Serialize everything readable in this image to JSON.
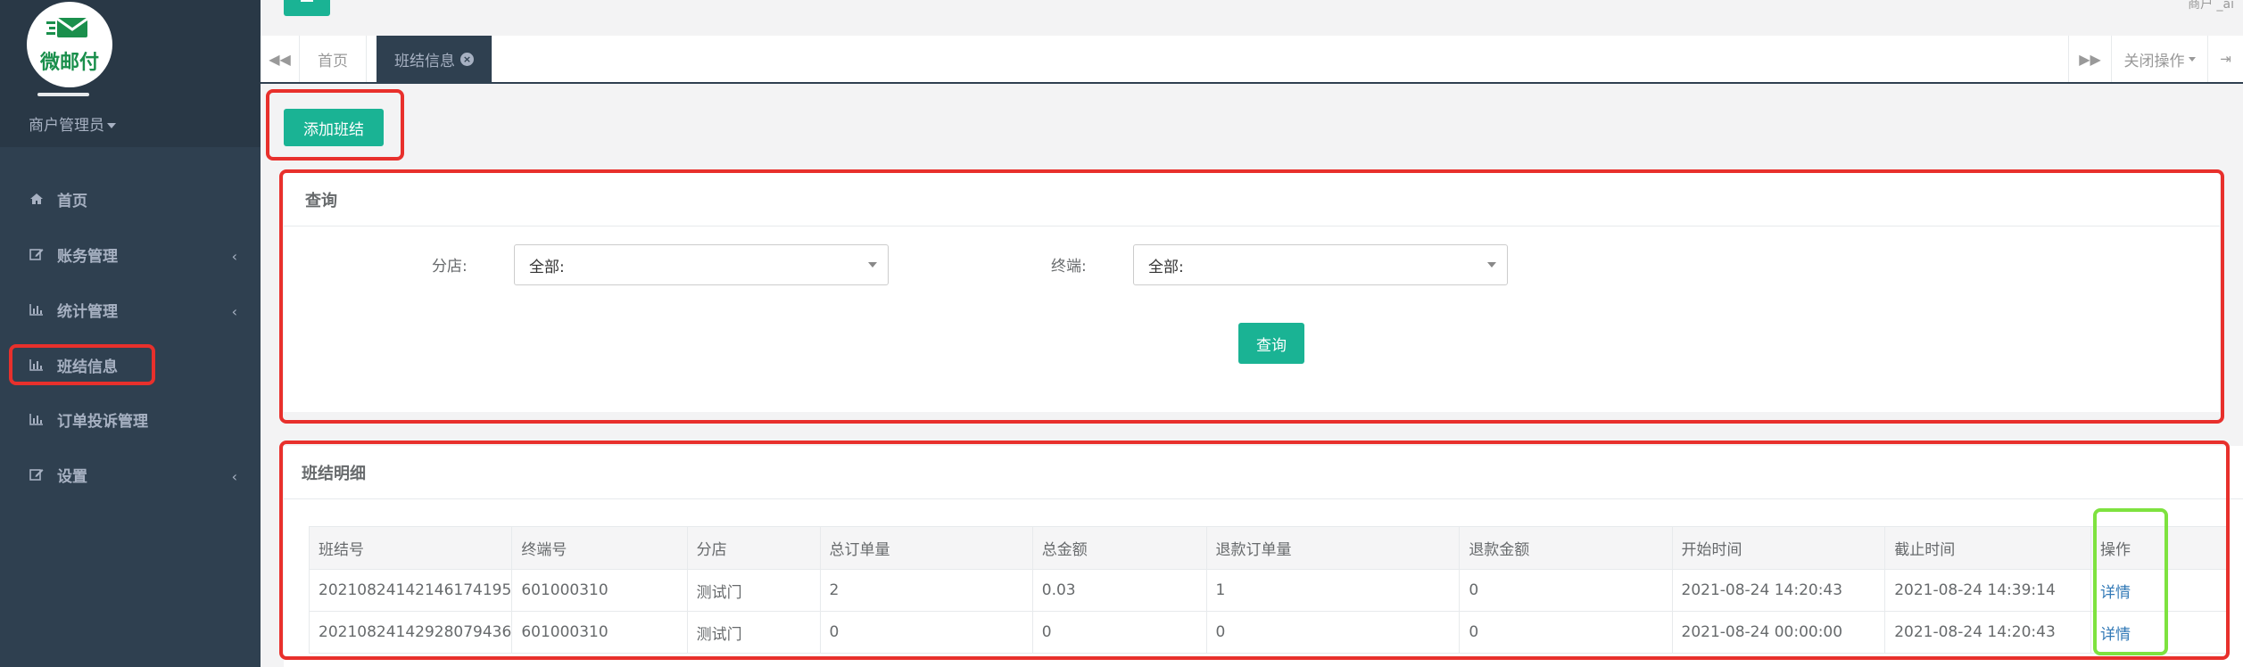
{
  "brand": {
    "logo_text": "微邮付"
  },
  "sidebar": {
    "role": "商户管理员",
    "items": [
      {
        "label": "首页",
        "icon": "home-icon",
        "has_children": false
      },
      {
        "label": "账务管理",
        "icon": "edit-icon",
        "has_children": true
      },
      {
        "label": "统计管理",
        "icon": "bar-chart-icon",
        "has_children": true
      },
      {
        "label": "班结信息",
        "icon": "bar-chart-icon",
        "has_children": false
      },
      {
        "label": "订单投诉管理",
        "icon": "bar-chart-icon",
        "has_children": false
      },
      {
        "label": "设置",
        "icon": "edit-icon",
        "has_children": true
      }
    ]
  },
  "topbar": {
    "right_text": "商户 _ai"
  },
  "tabs": {
    "items": [
      {
        "label": "首页",
        "active": false
      },
      {
        "label": "班结信息",
        "active": true
      }
    ],
    "ops_label": "关闭操作"
  },
  "toolbar": {
    "add_label": "添加班结"
  },
  "query": {
    "title": "查询",
    "branch_label": "分店:",
    "branch_value": "全部:",
    "terminal_label": "终端:",
    "terminal_value": "全部:",
    "submit_label": "查询"
  },
  "detail": {
    "title": "班结明细",
    "columns": [
      "班结号",
      "终端号",
      "分店",
      "总订单量",
      "总金额",
      "退款订单量",
      "退款金额",
      "开始时间",
      "截止时间",
      "操作"
    ],
    "rows": [
      [
        "20210824142146174195",
        "601000310",
        "测试门",
        "2",
        "0.03",
        "1",
        "0",
        "2021-08-24 14:20:43",
        "2021-08-24 14:39:14",
        "详情"
      ],
      [
        "20210824142928079436",
        "601000310",
        "测试门",
        "0",
        "0",
        "0",
        "0",
        "2021-08-24 00:00:00",
        "2021-08-24 14:20:43",
        "详情"
      ]
    ]
  },
  "colors": {
    "accent": "#1ab394",
    "sidebar": "#2f4050",
    "highlight_red": "#e8302c",
    "highlight_green": "#7ee23f",
    "link": "#337ab7"
  }
}
